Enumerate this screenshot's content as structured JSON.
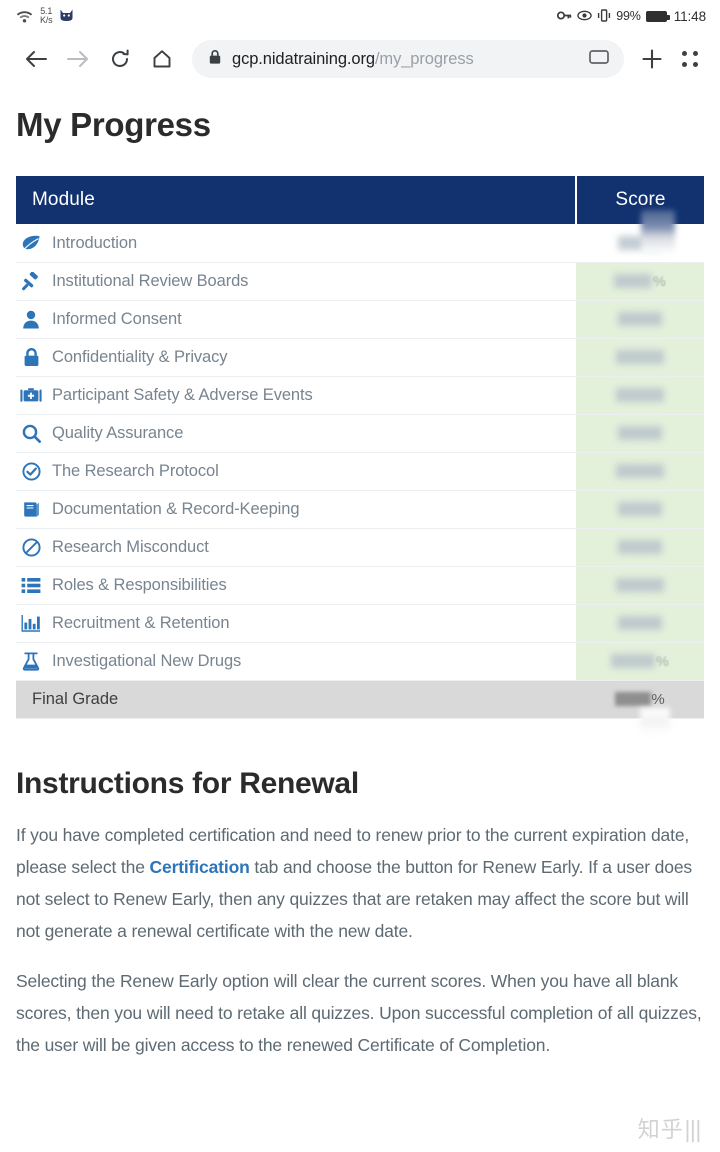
{
  "status_bar": {
    "network_speed_value": "5.1",
    "network_speed_unit": "K/s",
    "battery_percent": "99%",
    "time": "11:48",
    "icons": [
      "wifi-icon",
      "cat-icon",
      "key-icon",
      "eye-icon",
      "vibrate-icon",
      "battery-icon"
    ]
  },
  "browser": {
    "back_label": "Back",
    "forward_label": "Forward",
    "reload_label": "Reload",
    "home_label": "Home",
    "url_host": "gcp.nidatraining.org",
    "url_path": "/my_progress",
    "url_full": "gcp.nidatraining.org/my_progress",
    "security_icon": "lock-icon",
    "desktop_site_label": "Desktop site",
    "new_tab_label": "+",
    "menu_label": "Menu"
  },
  "page": {
    "title": "My Progress",
    "watermark": "知乎"
  },
  "table": {
    "headers": {
      "module": "Module",
      "score": "Score"
    },
    "rows": [
      {
        "icon": "leaf-icon",
        "label": "Introduction",
        "score": "",
        "score_suffix": "",
        "chip": "chip-w44"
      },
      {
        "icon": "gavel-icon",
        "label": "Institutional Review Boards",
        "score": "",
        "score_suffix": "%",
        "chip": "chip-w38"
      },
      {
        "icon": "person-icon",
        "label": "Informed Consent",
        "score": "",
        "score_suffix": "",
        "chip": "chip-w44"
      },
      {
        "icon": "lock-icon",
        "label": "Confidentiality & Privacy",
        "score": "",
        "score_suffix": "",
        "chip": "chip-w48"
      },
      {
        "icon": "first-aid-icon",
        "label": "Participant Safety & Adverse Events",
        "score": "",
        "score_suffix": "",
        "chip": "chip-w48"
      },
      {
        "icon": "magnifier-icon",
        "label": "Quality Assurance",
        "score": "",
        "score_suffix": "",
        "chip": "chip-w44"
      },
      {
        "icon": "check-circle-icon",
        "label": "The Research Protocol",
        "score": "",
        "score_suffix": "",
        "chip": "chip-w48"
      },
      {
        "icon": "book-icon",
        "label": "Documentation & Record-Keeping",
        "score": "",
        "score_suffix": "",
        "chip": "chip-w44"
      },
      {
        "icon": "no-entry-icon",
        "label": "Research Misconduct",
        "score": "",
        "score_suffix": "",
        "chip": "chip-w44"
      },
      {
        "icon": "list-icon",
        "label": "Roles & Responsibilities",
        "score": "",
        "score_suffix": "",
        "chip": "chip-w48"
      },
      {
        "icon": "bar-chart-icon",
        "label": "Recruitment & Retention",
        "score": "",
        "score_suffix": "",
        "chip": "chip-w44"
      },
      {
        "icon": "flask-icon",
        "label": "Investigational New Drugs",
        "score": "",
        "score_suffix": "%",
        "chip": "chip-w44"
      }
    ],
    "final_row": {
      "label": "Final Grade",
      "score": "",
      "score_suffix": "%"
    }
  },
  "instructions": {
    "title": "Instructions for Renewal",
    "paragraph1_before": "If you have completed certification and need to renew prior to the current expiration date, please select the ",
    "paragraph1_link": "Certification",
    "paragraph1_after": " tab and choose the button for Renew Early. If a user does not select to Renew Early, then any quizzes that are retaken may affect the score but will not generate a renewal certificate with the new date.",
    "paragraph2": "Selecting the Renew Early option will clear the current scores. When you have all blank scores, then you will need to retake all quizzes. Upon successful completion of all quizzes, the user will be given access to the renewed Certificate of Completion."
  },
  "colors": {
    "header_navy": "#12326f",
    "score_green": "#e3f0da",
    "final_grey": "#d9d9d9",
    "link_blue": "#2d74b8",
    "icon_blue": "#2d74b8",
    "body_text": "#5d6a72"
  }
}
